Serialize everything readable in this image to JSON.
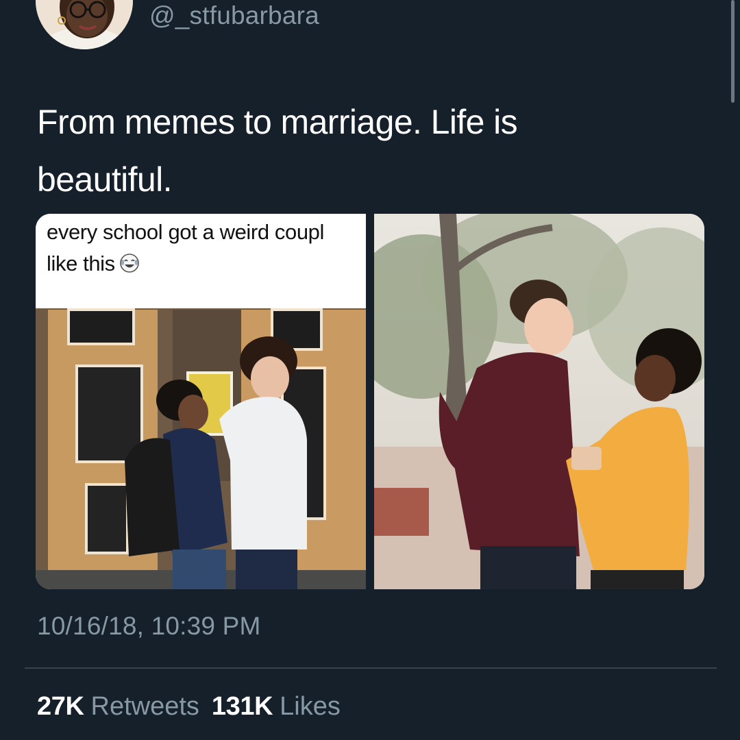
{
  "tweet": {
    "handle": "@_stfubarbara",
    "text": "From memes to marriage. Life is beautiful.",
    "timestamp": "10/16/18, 10:39 PM"
  },
  "media": {
    "meme_caption_line1": "every school got a weird coupl",
    "meme_caption_line2": "like this",
    "emoji": "laughing-crying-emoji"
  },
  "stats": {
    "retweets_count": "27K",
    "retweets_label": "Retweets",
    "likes_count": "131K",
    "likes_label": "Likes"
  },
  "colors": {
    "background": "#15202b",
    "text_primary": "#ffffff",
    "text_secondary": "#8899a6",
    "divider": "#38444d"
  }
}
